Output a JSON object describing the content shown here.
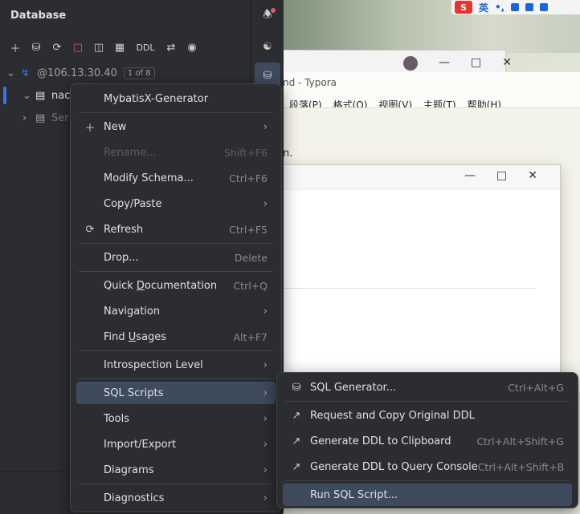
{
  "sidebar": {
    "title": "Database",
    "ddl_label": "DDL",
    "connection": {
      "host": "@106.13.30.40",
      "badge": "1 of 8"
    },
    "schema_label": "nac",
    "server_label": "Ser"
  },
  "typora": {
    "title": "nd - Typora",
    "menu": [
      "段落(P)",
      "格式(O)",
      "视图(V)",
      "主题(T)",
      "帮助(H)"
    ],
    "body_text": "n."
  },
  "ime": {
    "logo": "S",
    "lang": "英"
  },
  "context_menu": {
    "items": [
      {
        "label": "MybatisX-Generator",
        "shortcut": ""
      },
      {
        "label": "New",
        "shortcut": ""
      },
      {
        "label": "Rename...",
        "shortcut": "Shift+F6"
      },
      {
        "label": "Modify Schema...",
        "shortcut": "Ctrl+F6"
      },
      {
        "label": "Copy/Paste",
        "shortcut": ""
      },
      {
        "label": "Refresh",
        "shortcut": "Ctrl+F5"
      },
      {
        "label": "Drop...",
        "shortcut": "Delete"
      },
      {
        "label_pre": "Quick ",
        "label_u": "D",
        "label_post": "ocumentation",
        "shortcut": "Ctrl+Q"
      },
      {
        "label": "Navigation",
        "shortcut": ""
      },
      {
        "label_pre": "Find ",
        "label_u": "U",
        "label_post": "sages",
        "shortcut": "Alt+F7"
      },
      {
        "label": "Introspection Level",
        "shortcut": ""
      },
      {
        "label": "SQL Scripts",
        "shortcut": ""
      },
      {
        "label": "Tools",
        "shortcut": ""
      },
      {
        "label": "Import/Export",
        "shortcut": ""
      },
      {
        "label": "Diagrams",
        "shortcut": ""
      },
      {
        "label": "Diagnostics",
        "shortcut": ""
      }
    ]
  },
  "submenu": {
    "items": [
      {
        "label": "SQL Generator...",
        "shortcut": "Ctrl+Alt+G"
      },
      {
        "label": "Request and Copy Original DDL",
        "shortcut": ""
      },
      {
        "label": "Generate DDL to Clipboard",
        "shortcut": "Ctrl+Alt+Shift+G"
      },
      {
        "label": "Generate DDL to Query Console",
        "shortcut": "Ctrl+Alt+Shift+B"
      },
      {
        "label": "Run SQL Script...",
        "shortcut": ""
      }
    ]
  },
  "colors": {
    "selection": "#3d4b5c",
    "accent": "#3574f0",
    "menu_bg": "#2b2d30"
  }
}
